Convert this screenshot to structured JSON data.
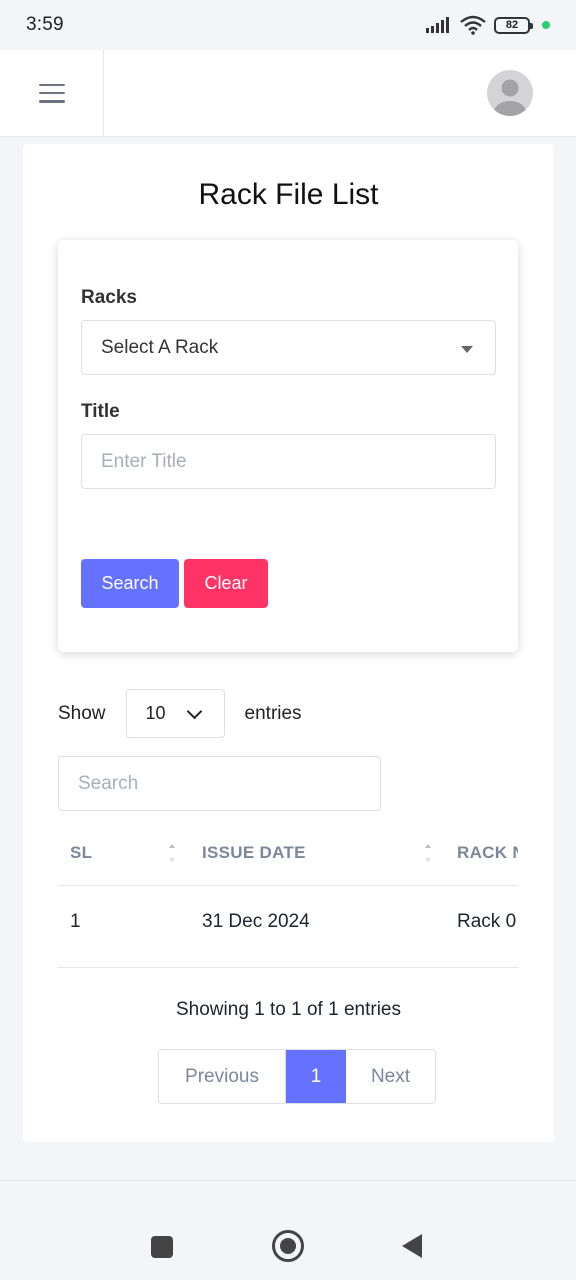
{
  "status_bar": {
    "time": "3:59",
    "battery": "82",
    "icons": [
      "signal-icon",
      "wifi-icon",
      "battery-icon"
    ]
  },
  "header": {
    "menu_icon": "hamburger-menu-icon",
    "avatar_icon": "user-avatar-icon"
  },
  "page": {
    "title": "Rack File List"
  },
  "filters": {
    "racks_label": "Racks",
    "racks_selected": "Select A Rack",
    "title_label": "Title",
    "title_placeholder": "Enter Title",
    "title_value": "",
    "search_button": "Search",
    "clear_button": "Clear",
    "colors": {
      "search": "#6571ff",
      "clear": "#ff3366"
    }
  },
  "table_controls": {
    "show_label": "Show",
    "page_length": "10",
    "entries_label": "entries",
    "search_placeholder": "Search"
  },
  "table": {
    "columns": [
      "SL",
      "ISSUE DATE",
      "RACK N"
    ],
    "rows": [
      [
        "1",
        "31 Dec 2024",
        "Rack 0"
      ]
    ]
  },
  "footer_info": "Showing 1 to 1 of 1 entries",
  "pagination": {
    "previous": "Previous",
    "current": "1",
    "next": "Next",
    "accent": "#6571ff"
  },
  "system_nav": {
    "icons": [
      "recents-square-icon",
      "home-circle-icon",
      "back-triangle-icon"
    ]
  }
}
